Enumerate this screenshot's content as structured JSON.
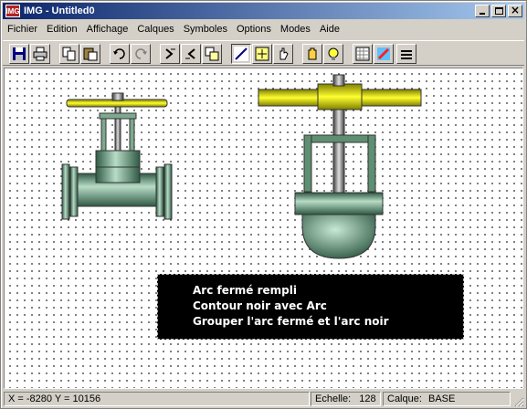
{
  "window": {
    "title": "IMG - Untitled0",
    "icon_text": "IMG"
  },
  "menu": [
    "Fichier",
    "Edition",
    "Affichage",
    "Calques",
    "Symboles",
    "Options",
    "Modes",
    "Aide"
  ],
  "toolbar": {
    "buttons": [
      "save-icon",
      "print-icon",
      "copy-icon",
      "paste-icon",
      "undo-icon",
      "redo-icon",
      "rotate-left-icon",
      "rotate-right-icon",
      "window-icon",
      "line-tool-icon",
      "move-tool-icon",
      "hand-pan-icon",
      "grab-hand-icon",
      "bulb-icon",
      "grid-icon",
      "pencil-icon",
      "menu-icon"
    ]
  },
  "canvas": {
    "text_lines": [
      "Arc fermé rempli",
      "Contour noir avec Arc",
      "Grouper l'arc fermé et l'arc noir"
    ]
  },
  "status": {
    "coords": "X = -8280  Y = 10156",
    "scale_label": "Echelle:",
    "scale_value": "128",
    "layer_label": "Calque:",
    "layer_value": "BASE"
  },
  "colors": {
    "titlebar": "#0a246a",
    "valve_green": "#6e9f82",
    "wheel_yellow": "#e6e600"
  }
}
